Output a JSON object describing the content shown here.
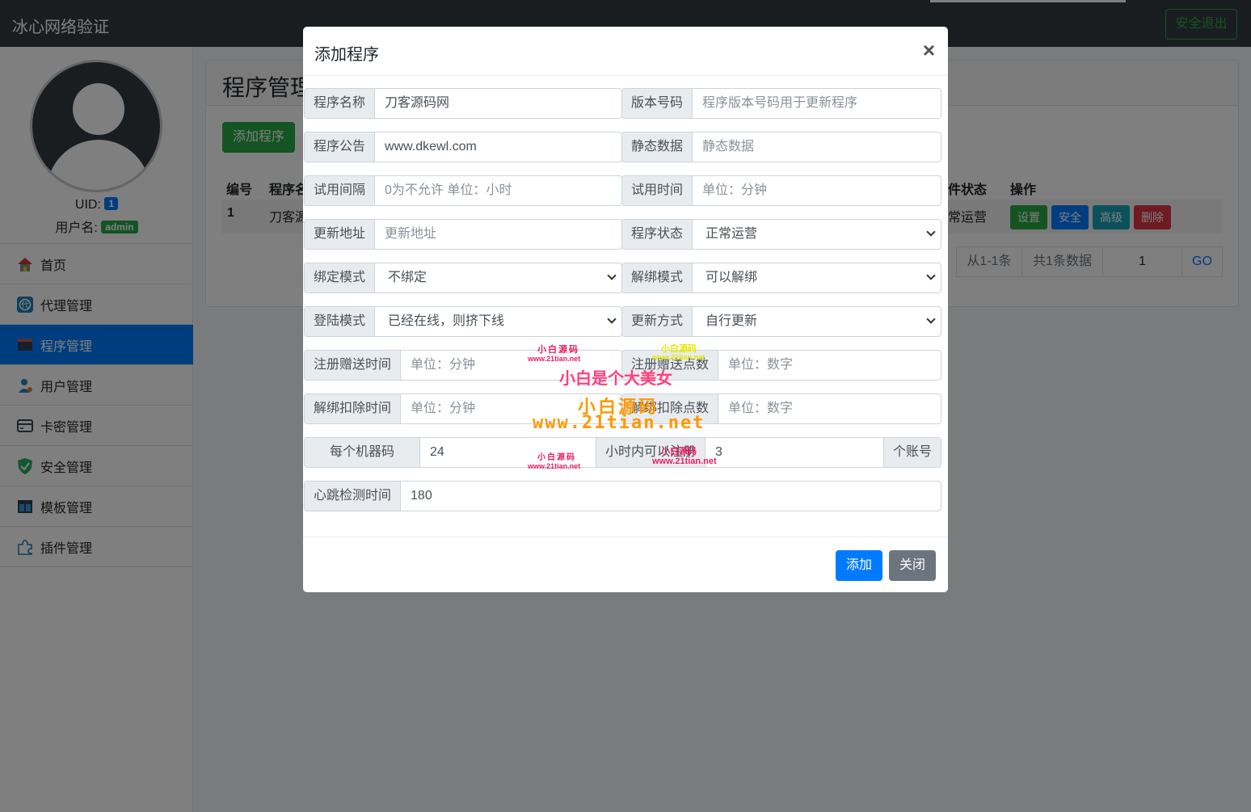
{
  "navbar": {
    "brand": "冰心网络验证",
    "logout": "安全退出"
  },
  "user": {
    "uid_label": "UID:",
    "uid_value": "1",
    "username_label": "用户名:",
    "username_value": "admin"
  },
  "sidebar": {
    "items": [
      {
        "label": "首页",
        "icon": "home-icon"
      },
      {
        "label": "代理管理",
        "icon": "agent-icon"
      },
      {
        "label": "程序管理",
        "icon": "program-icon",
        "active": true
      },
      {
        "label": "用户管理",
        "icon": "user-icon"
      },
      {
        "label": "卡密管理",
        "icon": "card-icon"
      },
      {
        "label": "安全管理",
        "icon": "shield-icon"
      },
      {
        "label": "模板管理",
        "icon": "template-icon"
      },
      {
        "label": "插件管理",
        "icon": "plugin-icon"
      }
    ]
  },
  "main": {
    "title": "程序管理",
    "add_button": "添加程序",
    "columns": {
      "id": "编号",
      "name": "程序名",
      "status": "件状态",
      "actions": "操作"
    },
    "row": {
      "id": "1",
      "name": "刀客源",
      "status": "常运营"
    },
    "actions": {
      "settings": "设置",
      "security": "安全",
      "advanced": "高级",
      "delete": "删除"
    },
    "pager": {
      "range": "从1-1条",
      "total": "共1条数据",
      "page": "1",
      "go": "GO"
    }
  },
  "modal": {
    "title": "添加程序",
    "close": "×",
    "fields": {
      "name": {
        "label": "程序名称",
        "value": "刀客源码网"
      },
      "version": {
        "label": "版本号码",
        "placeholder": "程序版本号码用于更新程序"
      },
      "notice": {
        "label": "程序公告",
        "value": "www.dkewl.com"
      },
      "static": {
        "label": "静态数据",
        "placeholder": "静态数据"
      },
      "trial_interval": {
        "label": "试用间隔",
        "placeholder": "0为不允许 单位：小时"
      },
      "trial_time": {
        "label": "试用时间",
        "placeholder": "单位：分钟"
      },
      "update_url": {
        "label": "更新地址",
        "placeholder": "更新地址"
      },
      "program_status": {
        "label": "程序状态",
        "value": "正常运营"
      },
      "bind_mode": {
        "label": "绑定模式",
        "value": "不绑定"
      },
      "unbind_mode": {
        "label": "解绑模式",
        "value": "可以解绑"
      },
      "login_mode": {
        "label": "登陆模式",
        "value": "已经在线，则挤下线"
      },
      "update_mode": {
        "label": "更新方式",
        "value": "自行更新"
      },
      "reg_gift_time": {
        "label": "注册赠送时间",
        "placeholder": "单位：分钟"
      },
      "reg_gift_points": {
        "label": "注册赠送点数",
        "placeholder": "单位：数字"
      },
      "unbind_deduct_time": {
        "label": "解绑扣除时间",
        "placeholder": "单位：分钟"
      },
      "unbind_deduct_points": {
        "label": "解绑扣除点数",
        "placeholder": "单位：数字"
      },
      "per_machine": {
        "label": "每个机器码",
        "value": "24"
      },
      "hours_register": {
        "label": "小时内可以注册",
        "value": "3",
        "suffix": "个账号"
      },
      "heartbeat": {
        "label": "心跳检测时间",
        "value": "180"
      }
    },
    "add_button": "添加",
    "close_button": "关闭"
  },
  "watermark": {
    "small_cn": "小白源码",
    "small_url": "www.21tian.net",
    "main_text": "小白是个大美女",
    "big_cn": "小白源码",
    "big_url": "www.21tian.net"
  }
}
